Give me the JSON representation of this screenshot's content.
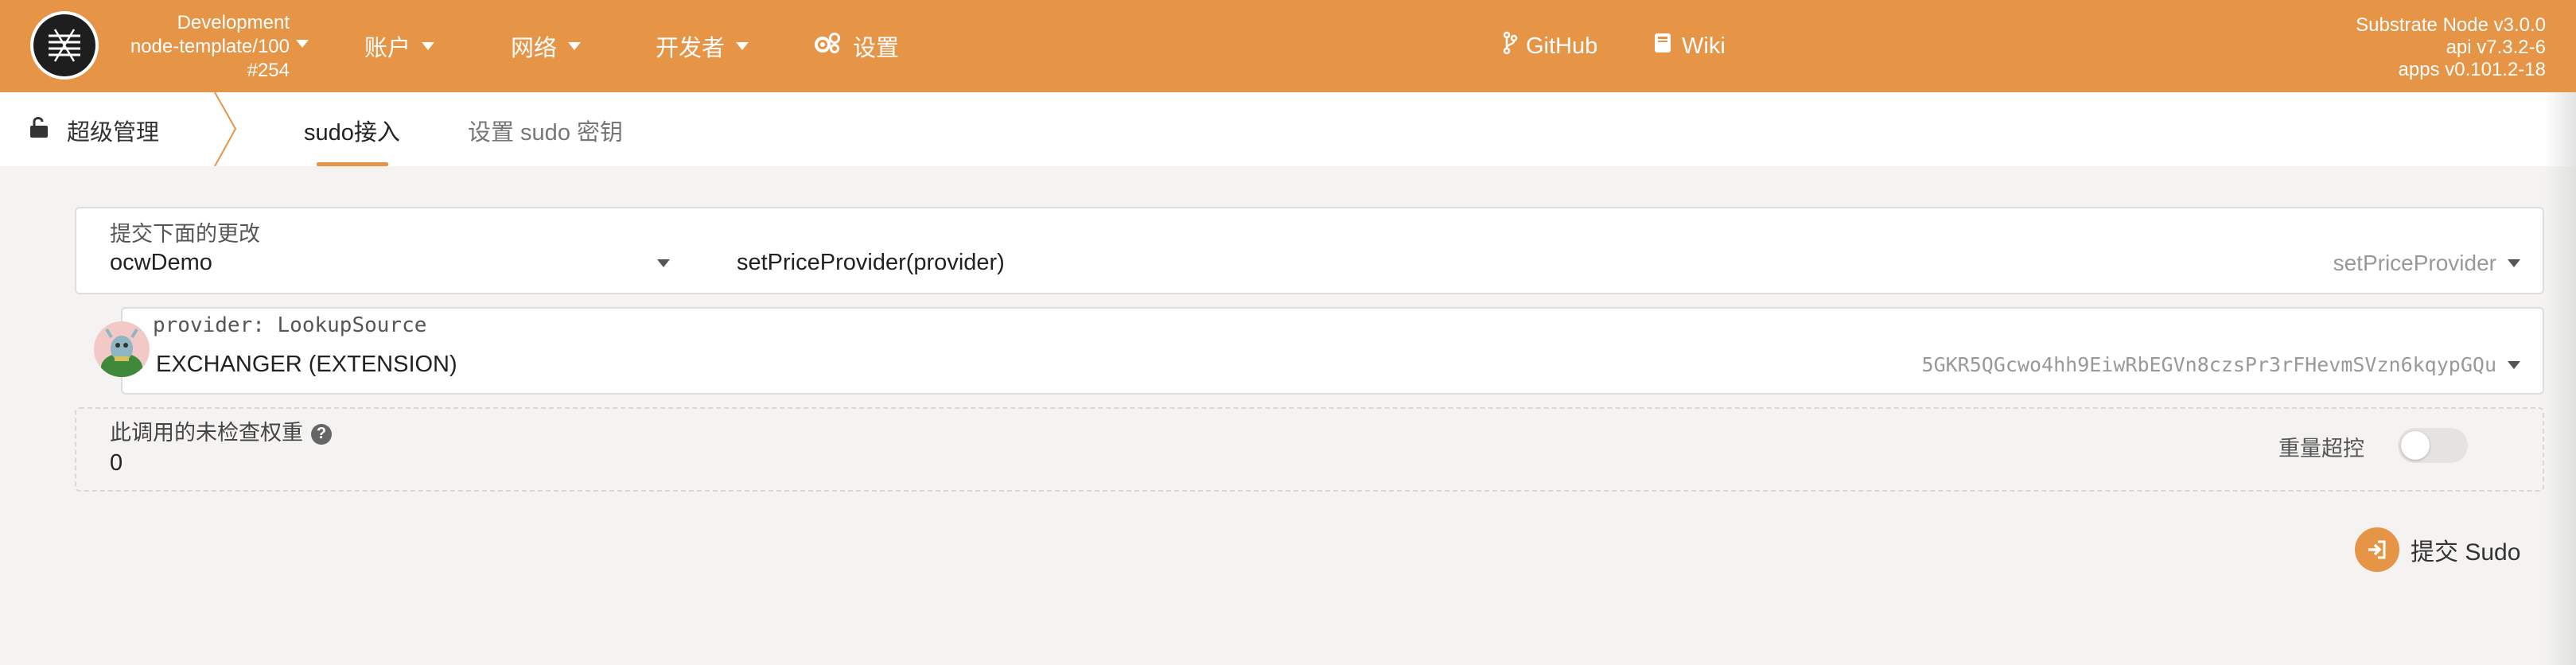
{
  "header": {
    "chain": {
      "name": "Development",
      "runtime": "node-template/100",
      "block": "#254"
    },
    "nav": [
      {
        "label": "账户",
        "has_dropdown": true
      },
      {
        "label": "网络",
        "has_dropdown": true
      },
      {
        "label": "开发者",
        "has_dropdown": true
      },
      {
        "label": "设置",
        "has_dropdown": false,
        "icon": "gears-icon"
      }
    ],
    "links": [
      {
        "label": "GitHub",
        "icon": "git-branch-icon"
      },
      {
        "label": "Wiki",
        "icon": "book-icon"
      }
    ],
    "version": {
      "node": "Substrate Node v3.0.0",
      "api": "api v7.3.2-6",
      "apps": "apps v0.101.2-18"
    }
  },
  "tabs": {
    "section_title": "超级管理",
    "section_icon": "unlock-icon",
    "items": [
      {
        "label": "sudo接入",
        "active": true
      },
      {
        "label": "设置 sudo 密钥",
        "active": false
      }
    ]
  },
  "form": {
    "extrinsic_label": "提交下面的更改",
    "module_value": "ocwDemo",
    "call_value": "setPriceProvider(provider)",
    "call_hint": "setPriceProvider",
    "param_label": "provider: LookupSource",
    "account_name": "EXCHANGER (EXTENSION)",
    "account_address": "5GKR5QGcwo4hh9EiwRbEGVn8czsPr3rFHevmSVzn6kqypGQu",
    "weight_label": "此调用的未检查权重",
    "weight_value": "0",
    "override_label": "重量超控",
    "override_enabled": false,
    "submit_label": "提交 Sudo"
  },
  "colors": {
    "accent": "#e69446",
    "background": "#f4f3f1"
  }
}
